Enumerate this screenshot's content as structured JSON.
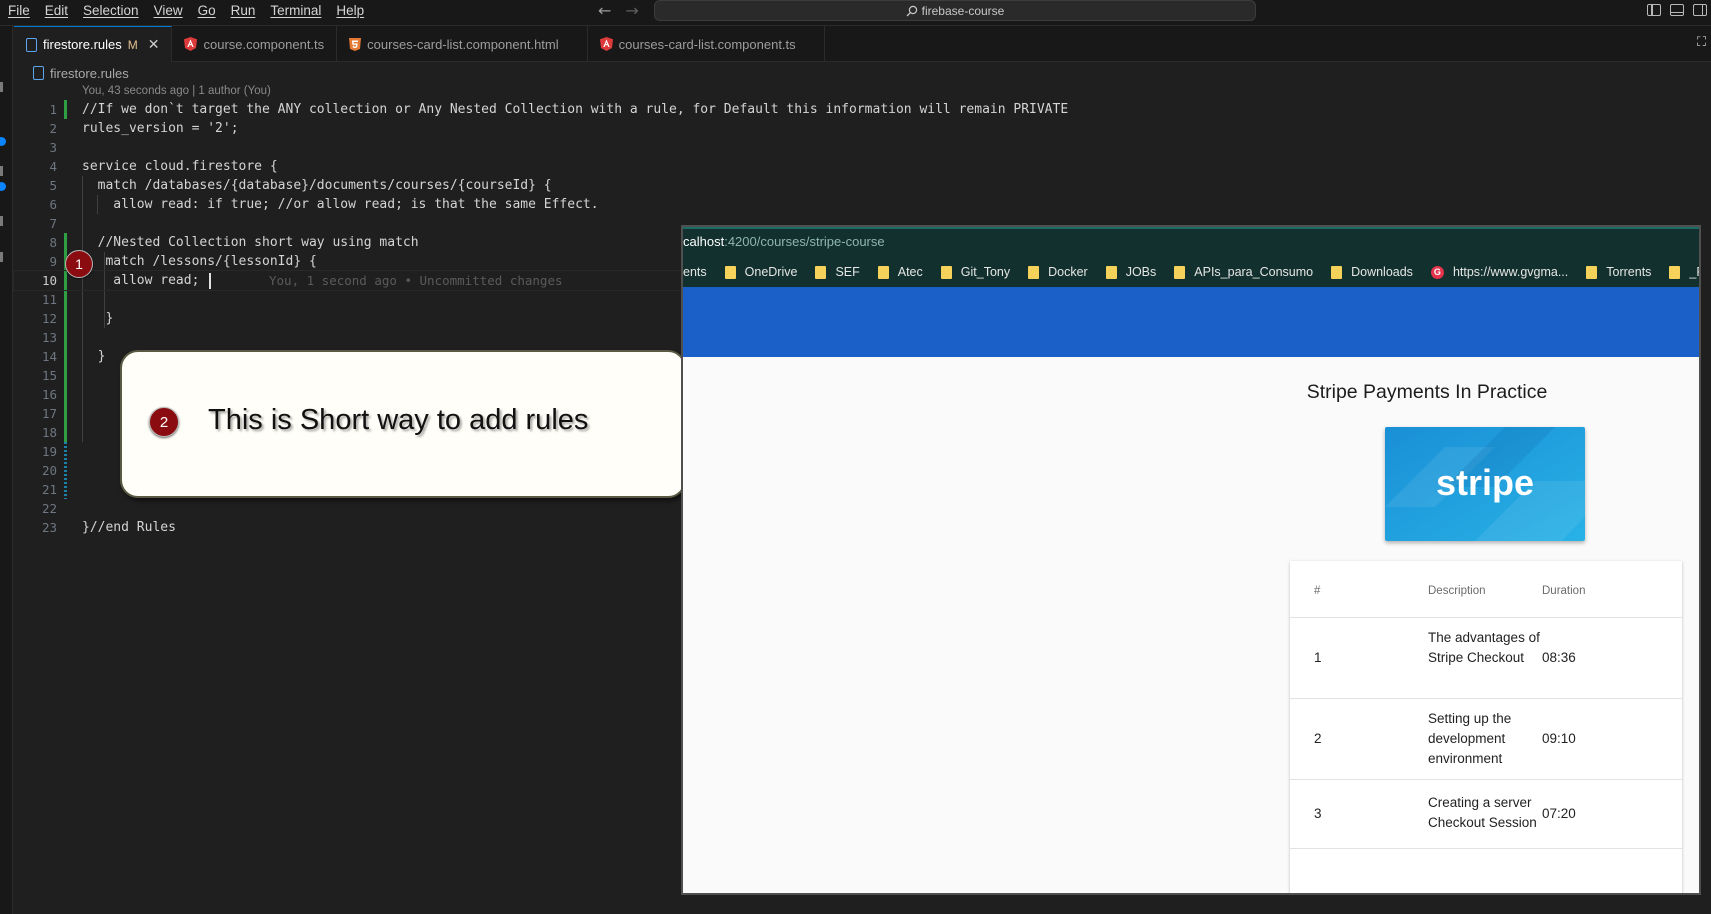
{
  "menu": [
    "File",
    "Edit",
    "Selection",
    "View",
    "Go",
    "Run",
    "Terminal",
    "Help"
  ],
  "command_center": {
    "text": "firebase-course",
    "icon": "search-icon"
  },
  "tabs": [
    {
      "label": "firestore.rules",
      "status": "M",
      "icon": "file-icon",
      "active": true
    },
    {
      "label": "course.component.ts",
      "icon": "angular-icon"
    },
    {
      "label": "courses-card-list.component.html",
      "icon": "html-icon"
    },
    {
      "label": "courses-card-list.component.ts",
      "icon": "angular-icon"
    }
  ],
  "breadcrumb": "firestore.rules",
  "blame_header": "You, 43 seconds ago | 1 author (You)",
  "code_lines": [
    {
      "n": "1",
      "text": "//If we don`t target the ANY collection or Any Nested Collection with a rule, for Default this information will remain PRIVATE"
    },
    {
      "n": "2",
      "text": "rules_version = '2';"
    },
    {
      "n": "3",
      "text": ""
    },
    {
      "n": "4",
      "text": "service cloud.firestore {"
    },
    {
      "n": "5",
      "text": "  match /databases/{database}/documents/courses/{courseId} {"
    },
    {
      "n": "6",
      "text": "    allow read: if true; //or allow read; is that the same Effect."
    },
    {
      "n": "7",
      "text": ""
    },
    {
      "n": "8",
      "text": "  //Nested Collection short way using match"
    },
    {
      "n": "9",
      "text": "   match /lessons/{lessonId} {"
    },
    {
      "n": "10",
      "text": "    allow read; "
    },
    {
      "n": "11",
      "text": ""
    },
    {
      "n": "12",
      "text": "   }"
    },
    {
      "n": "13",
      "text": ""
    },
    {
      "n": "14",
      "text": "  }"
    },
    {
      "n": "15",
      "text": ""
    },
    {
      "n": "16",
      "text": ""
    },
    {
      "n": "17",
      "text": ""
    },
    {
      "n": "18",
      "text": ""
    },
    {
      "n": "19",
      "text": ""
    },
    {
      "n": "20",
      "text": ""
    },
    {
      "n": "21",
      "text": ""
    },
    {
      "n": "22",
      "text": ""
    },
    {
      "n": "23",
      "text": "}//end Rules"
    }
  ],
  "ghost_text": "You, 1 second ago • Uncommitted changes",
  "annotations": {
    "badge1": "1",
    "badge2": "2",
    "callout_text": "This is Short way to add rules"
  },
  "browser": {
    "address_host": "calhost",
    "address_path": ":4200/courses/stripe-course",
    "bookmarks": [
      {
        "label": "ents",
        "icon": "folder-icon"
      },
      {
        "label": "OneDrive",
        "icon": "folder-icon"
      },
      {
        "label": "SEF",
        "icon": "folder-icon"
      },
      {
        "label": "Atec",
        "icon": "folder-icon"
      },
      {
        "label": "Git_Tony",
        "icon": "folder-icon"
      },
      {
        "label": "Docker",
        "icon": "folder-icon"
      },
      {
        "label": "JOBs",
        "icon": "folder-icon"
      },
      {
        "label": "APIs_para_Consumo",
        "icon": "folder-icon"
      },
      {
        "label": "Downloads",
        "icon": "folder-icon"
      },
      {
        "label": "https://www.gvgma...",
        "icon": "google-icon"
      },
      {
        "label": "Torrents",
        "icon": "folder-icon"
      },
      {
        "label": "_Fron",
        "icon": "folder-icon"
      }
    ],
    "toolbar_color": "#1b5fc8",
    "course_title": "Stripe Payments In Practice",
    "course_logo_text": "stripe",
    "table": {
      "headers": [
        "#",
        "Description",
        "Duration"
      ],
      "rows": [
        {
          "num": "1",
          "desc": "The advantages of Stripe Checkout",
          "dur": "08:36"
        },
        {
          "num": "2",
          "desc": "Setting up the development environment",
          "dur": "09:10"
        },
        {
          "num": "3",
          "desc": "Creating a server Checkout Session",
          "dur": "07:20"
        }
      ]
    }
  }
}
